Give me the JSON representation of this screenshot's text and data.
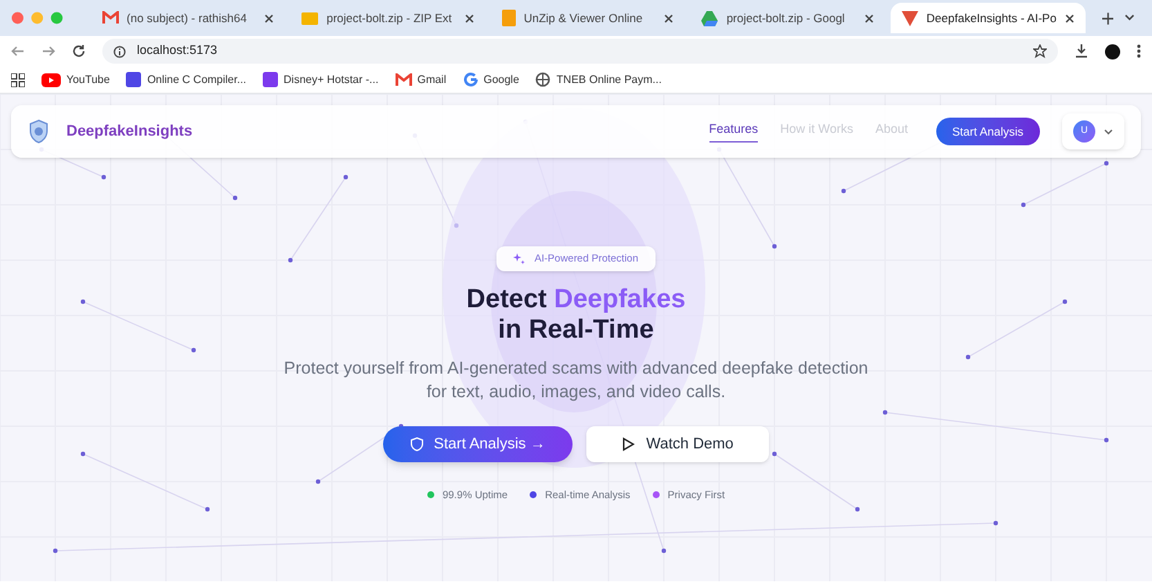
{
  "browser": {
    "tabs": [
      {
        "title": "(no subject) - rathish64",
        "selected": false
      },
      {
        "title": "project-bolt.zip - ZIP Ext",
        "selected": false
      },
      {
        "title": "UnZip & Viewer Online",
        "selected": false
      },
      {
        "title": "project-bolt.zip - Googl",
        "selected": false
      },
      {
        "title": "DeepfakeInsights - AI-Po",
        "selected": true
      }
    ],
    "address": "localhost:5173",
    "bookmarks": [
      {
        "label": "YouTube"
      },
      {
        "label": "Online C Compiler..."
      },
      {
        "label": "Disney+ Hotstar -..."
      },
      {
        "label": "Gmail"
      },
      {
        "label": "Google"
      },
      {
        "label": "TNEB Online Paym..."
      }
    ]
  },
  "navbar": {
    "brand": "DeepfakeInsights",
    "links": [
      {
        "label": "Features",
        "selected": true
      },
      {
        "label": "How it Works",
        "selected": false
      },
      {
        "label": "About",
        "selected": false
      }
    ],
    "cta": "Start Analysis",
    "avatar": "U"
  },
  "hero": {
    "badge": "AI-Powered Protection",
    "title_plain": "Detect",
    "title_accent": "Deepfakes",
    "title_line2": "in Real-Time",
    "subtitle": "Protect yourself from AI-generated scams with advanced deepfake detection for text, audio, images, and video calls.",
    "primary_button": "Start Analysis →",
    "secondary_button": "Watch Demo",
    "stats": [
      {
        "label": "99.9% Uptime",
        "color": "#22c55e"
      },
      {
        "label": "Real-time Analysis",
        "color": "#4f46e5"
      },
      {
        "label": "Privacy First",
        "color": "#a855f7"
      }
    ]
  }
}
